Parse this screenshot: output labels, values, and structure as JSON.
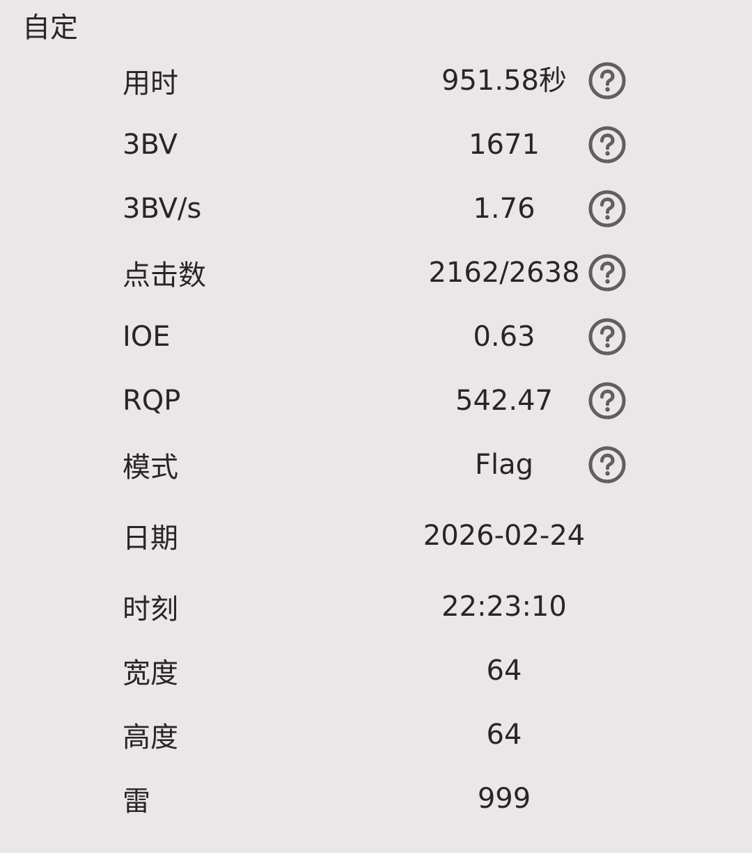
{
  "header": {
    "title": "自定"
  },
  "stats": [
    {
      "label": "用时",
      "value": "951.58秒",
      "help": true
    },
    {
      "label": "3BV",
      "value": "1671",
      "help": true
    },
    {
      "label": "3BV/s",
      "value": "1.76",
      "help": true
    },
    {
      "label": "点击数",
      "value": "2162/2638",
      "help": true
    },
    {
      "label": "IOE",
      "value": "0.63",
      "help": true
    },
    {
      "label": "RQP",
      "value": "542.47",
      "help": true
    },
    {
      "label": "模式",
      "value": "Flag",
      "help": true
    },
    {
      "label": "日期",
      "value": "2026-02-24",
      "help": false
    },
    {
      "label": "时刻",
      "value": "22:23:10",
      "help": false
    },
    {
      "label": "宽度",
      "value": "64",
      "help": false
    },
    {
      "label": "高度",
      "value": "64",
      "help": false
    },
    {
      "label": "雷",
      "value": "999",
      "help": false
    }
  ],
  "icons": {
    "help": "question-circle-icon"
  },
  "colors": {
    "background": "#ebe6e7",
    "text": "#2a2426",
    "icon": "#5f5f5f"
  }
}
